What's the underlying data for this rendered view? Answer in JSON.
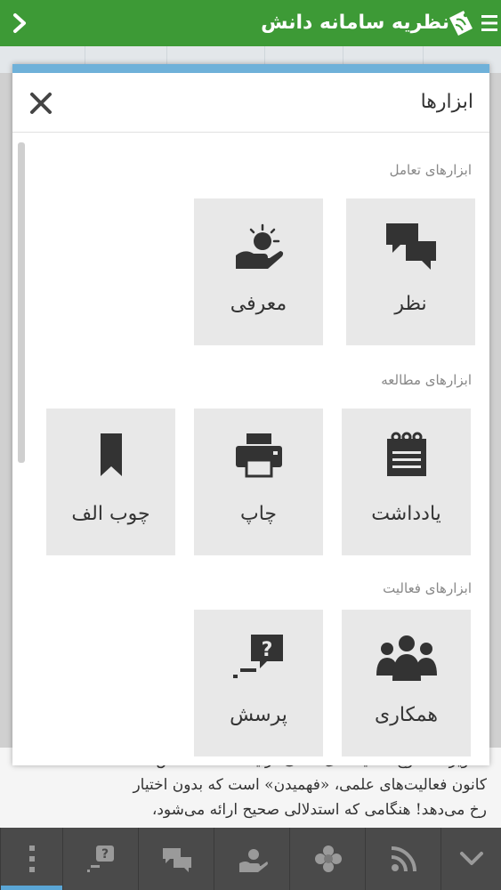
{
  "header": {
    "title": "نظریه سامانه دانش",
    "back_icon": "chevron-right-icon",
    "menu_icon": "hamburger-icon",
    "logo_icon": "app-logo-icon"
  },
  "modal": {
    "title": "ابزارها",
    "close_icon": "close-icon",
    "sections": [
      {
        "heading": "ابزارهای تعامل",
        "tools": [
          {
            "label": "نظر",
            "icon": "comments-icon"
          },
          {
            "label": "معرفی",
            "icon": "recommend-hand-icon"
          }
        ]
      },
      {
        "heading": "ابزارهای مطالعه",
        "tools": [
          {
            "label": "یادداشت",
            "icon": "notepad-icon"
          },
          {
            "label": "چاپ",
            "icon": "printer-icon"
          },
          {
            "label": "چوب الف",
            "icon": "bookmark-icon"
          }
        ]
      },
      {
        "heading": "ابزارهای فعالیت",
        "tools": [
          {
            "label": "همکاری",
            "icon": "group-icon"
          },
          {
            "label": "پرسش",
            "icon": "question-bubble-icon"
          }
        ]
      }
    ]
  },
  "background_text": {
    "line1": "تصویر: سطوح فعالیت‌های علمی در یک سامانه دانش",
    "line2": "کانون فعالیت‌های علمی، «فهمیدن» است که بدون اختیار",
    "line3": "رخ می‌دهد! هنگامی که استدلالی صحیح ارائه می‌شود،"
  },
  "bottom_bar": {
    "items": [
      "more-vertical-icon",
      "question-icon",
      "comments-icon",
      "recommend-hand-icon",
      "flower-icon",
      "rss-icon",
      "chevron-down-icon"
    ]
  },
  "colors": {
    "header_green": "#3d9a36",
    "modal_accent": "#6fb1d9",
    "bottom_bar": "#4a4a4a",
    "tile_bg": "#e8e8e8",
    "active_indicator": "#5aa6d6"
  }
}
